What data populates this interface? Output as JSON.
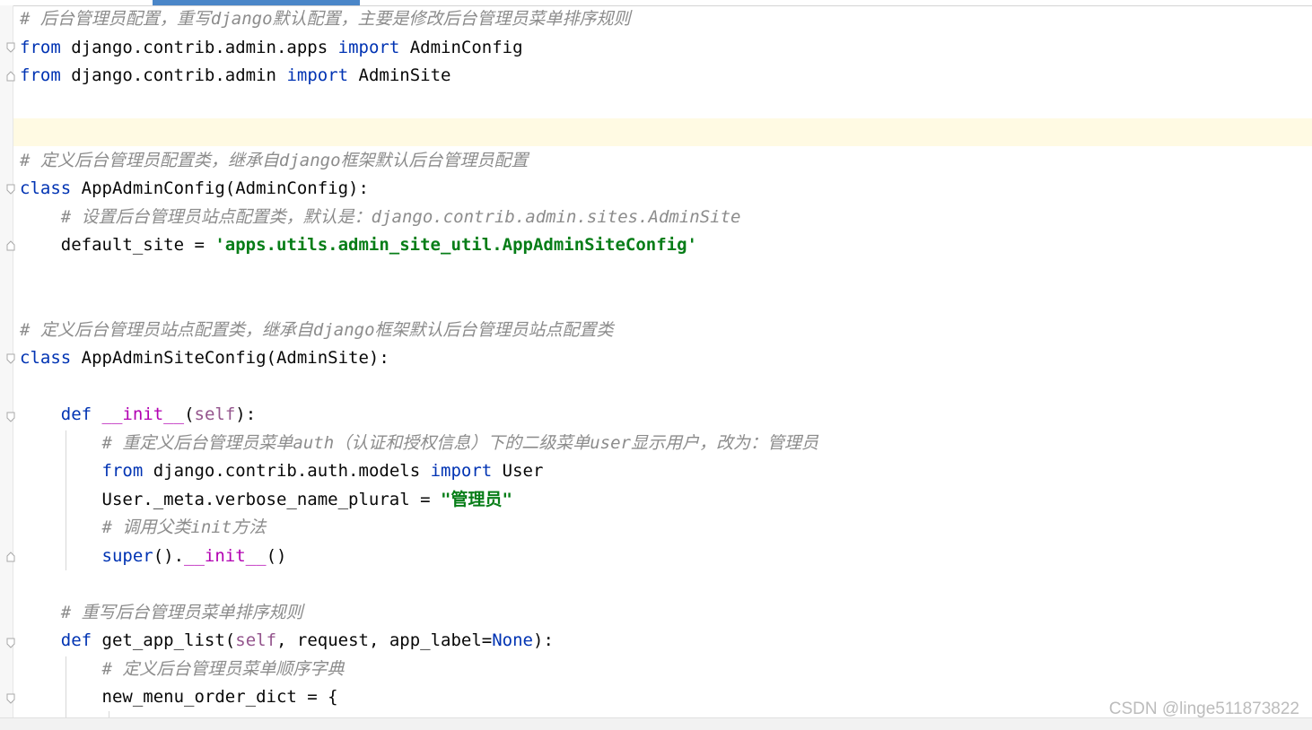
{
  "editor": {
    "lines": [
      {
        "segments": [
          {
            "t": "# ",
            "c": "cm"
          },
          {
            "t": "后台管理员配置，重写",
            "c": "cm zh"
          },
          {
            "t": "django",
            "c": "cm"
          },
          {
            "t": "默认配置，主要是修改后台管理员菜单排序规则",
            "c": "cm zh"
          }
        ]
      },
      {
        "segments": [
          {
            "t": "from",
            "c": "kw"
          },
          {
            "t": " django.contrib.admin.apps ",
            "c": ""
          },
          {
            "t": "import",
            "c": "kw"
          },
          {
            "t": " AdminConfig",
            "c": ""
          }
        ]
      },
      {
        "segments": [
          {
            "t": "from",
            "c": "kw"
          },
          {
            "t": " django.contrib.admin ",
            "c": ""
          },
          {
            "t": "import",
            "c": "kw"
          },
          {
            "t": " AdminSite",
            "c": ""
          }
        ]
      },
      {
        "segments": []
      },
      {
        "segments": []
      },
      {
        "segments": [
          {
            "t": "# ",
            "c": "cm"
          },
          {
            "t": "定义后台管理员配置类，继承自",
            "c": "cm zh"
          },
          {
            "t": "django",
            "c": "cm"
          },
          {
            "t": "框架默认后台管理员配置",
            "c": "cm zh"
          }
        ]
      },
      {
        "segments": [
          {
            "t": "class",
            "c": "kw"
          },
          {
            "t": " AppAdminConfig(AdminConfig):",
            "c": ""
          }
        ]
      },
      {
        "segments": [
          {
            "t": "    ",
            "c": ""
          },
          {
            "t": "# ",
            "c": "cm"
          },
          {
            "t": "设置后台管理员站点配置类，默认是：",
            "c": "cm zh"
          },
          {
            "t": "django.contrib.admin.sites.AdminSite",
            "c": "cm"
          }
        ]
      },
      {
        "segments": [
          {
            "t": "    default_site = ",
            "c": ""
          },
          {
            "t": "'apps.utils.admin_site_util.AppAdminSiteConfig'",
            "c": "str"
          }
        ]
      },
      {
        "segments": []
      },
      {
        "segments": []
      },
      {
        "segments": [
          {
            "t": "# ",
            "c": "cm"
          },
          {
            "t": "定义后台管理员站点配置类，继承自",
            "c": "cm zh"
          },
          {
            "t": "django",
            "c": "cm"
          },
          {
            "t": "框架默认后台管理员站点配置类",
            "c": "cm zh"
          }
        ]
      },
      {
        "segments": [
          {
            "t": "class",
            "c": "kw"
          },
          {
            "t": " AppAdminSiteConfig(AdminSite):",
            "c": ""
          }
        ]
      },
      {
        "segments": []
      },
      {
        "segments": [
          {
            "t": "    ",
            "c": ""
          },
          {
            "t": "def",
            "c": "kw"
          },
          {
            "t": " ",
            "c": ""
          },
          {
            "t": "__init__",
            "c": "magic"
          },
          {
            "t": "(",
            "c": ""
          },
          {
            "t": "self",
            "c": "self"
          },
          {
            "t": "):",
            "c": ""
          }
        ]
      },
      {
        "segments": [
          {
            "t": "        ",
            "c": ""
          },
          {
            "t": "# ",
            "c": "cm"
          },
          {
            "t": "重定义后台管理员菜单",
            "c": "cm zh"
          },
          {
            "t": "auth",
            "c": "cm"
          },
          {
            "t": "（认证和授权信息）下的二级菜单",
            "c": "cm zh"
          },
          {
            "t": "user",
            "c": "cm"
          },
          {
            "t": "显示用户，改为：管理员",
            "c": "cm zh"
          }
        ]
      },
      {
        "segments": [
          {
            "t": "        ",
            "c": ""
          },
          {
            "t": "from",
            "c": "kw"
          },
          {
            "t": " django.contrib.auth.models ",
            "c": ""
          },
          {
            "t": "import",
            "c": "kw"
          },
          {
            "t": " User",
            "c": ""
          }
        ]
      },
      {
        "segments": [
          {
            "t": "        User._meta.verbose_name_plural = ",
            "c": ""
          },
          {
            "t": "\"",
            "c": "str2"
          },
          {
            "t": "管理员",
            "c": "str2 zh"
          },
          {
            "t": "\"",
            "c": "str2"
          }
        ]
      },
      {
        "segments": [
          {
            "t": "        ",
            "c": ""
          },
          {
            "t": "# ",
            "c": "cm"
          },
          {
            "t": "调用父类",
            "c": "cm zh"
          },
          {
            "t": "init",
            "c": "cm"
          },
          {
            "t": "方法",
            "c": "cm zh"
          }
        ]
      },
      {
        "segments": [
          {
            "t": "        ",
            "c": ""
          },
          {
            "t": "super",
            "c": "kw"
          },
          {
            "t": "().",
            "c": ""
          },
          {
            "t": "__init__",
            "c": "magic"
          },
          {
            "t": "()",
            "c": ""
          }
        ]
      },
      {
        "segments": []
      },
      {
        "segments": [
          {
            "t": "    ",
            "c": ""
          },
          {
            "t": "# ",
            "c": "cm"
          },
          {
            "t": "重写后台管理员菜单排序规则",
            "c": "cm zh"
          }
        ]
      },
      {
        "segments": [
          {
            "t": "    ",
            "c": ""
          },
          {
            "t": "def",
            "c": "kw"
          },
          {
            "t": " get_app_list(",
            "c": ""
          },
          {
            "t": "self",
            "c": "self"
          },
          {
            "t": ", request, app_label=",
            "c": ""
          },
          {
            "t": "None",
            "c": "none"
          },
          {
            "t": "):",
            "c": ""
          }
        ]
      },
      {
        "segments": [
          {
            "t": "        ",
            "c": ""
          },
          {
            "t": "# ",
            "c": "cm"
          },
          {
            "t": "定义后台管理员菜单顺序字典",
            "c": "cm zh"
          }
        ]
      },
      {
        "segments": [
          {
            "t": "        new_menu_order_dict = {",
            "c": ""
          }
        ]
      }
    ]
  },
  "watermark": "CSDN @linge511873822",
  "colors": {
    "keyword": "#0033b3",
    "comment": "#8c8c8c",
    "string": "#067d17",
    "self": "#94558d",
    "magic": "#b200b2",
    "caret_row": "#fffae3",
    "tab_indicator": "#4a86c8"
  }
}
